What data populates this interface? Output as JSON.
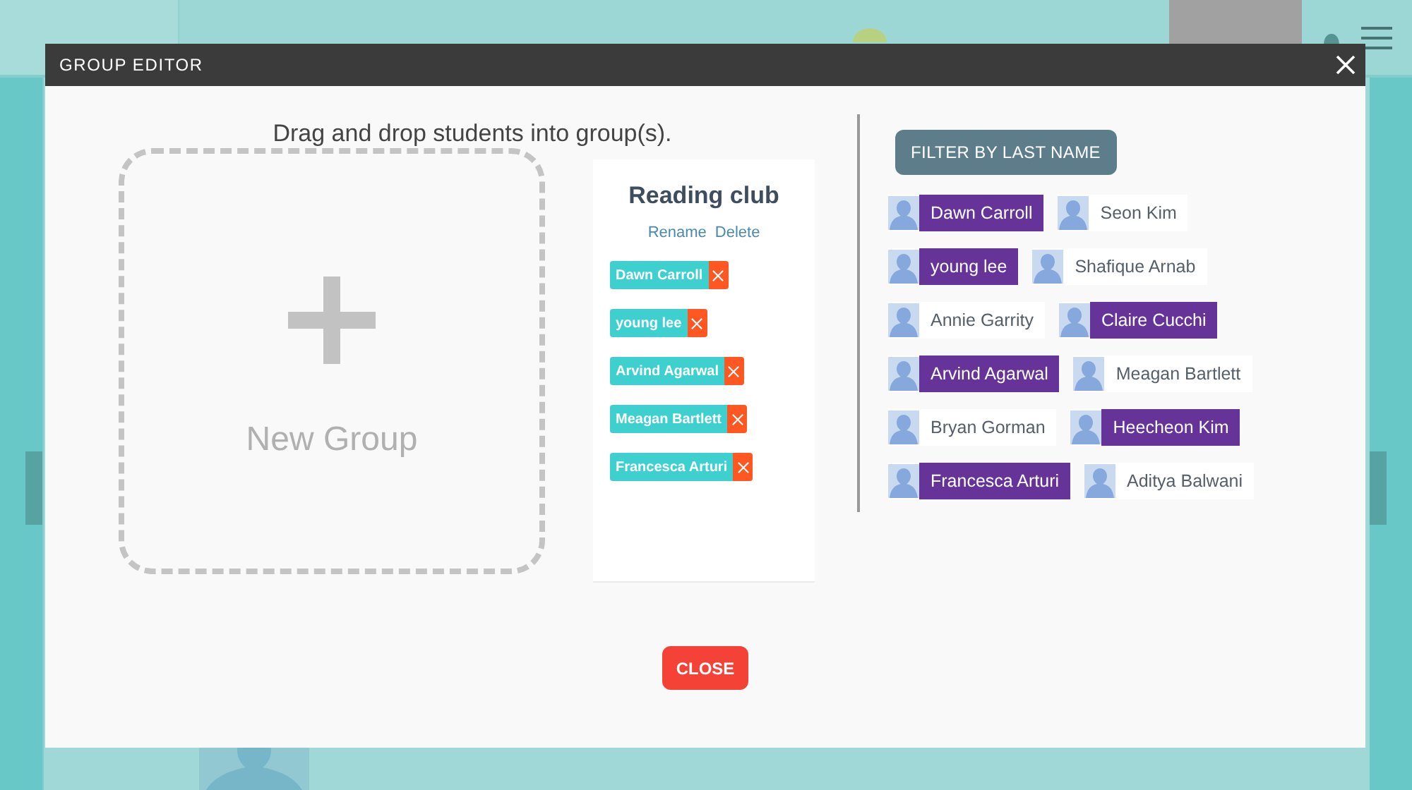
{
  "nav": {
    "tabs": [
      {
        "selected": true
      },
      {
        "selected": false
      }
    ]
  },
  "dialog": {
    "title": "GROUP EDITOR",
    "instructions": "Drag and drop students into group(s).",
    "new_group": "New Group",
    "groups": [
      {
        "name": "Reading club",
        "actions": [
          "Rename",
          "Delete"
        ],
        "members": [
          "Dawn Carroll",
          "young lee",
          "Arvind Agarwal",
          "Meagan Bartlett",
          "Francesca Arturi"
        ]
      }
    ],
    "filter_button": "FILTER BY LAST NAME",
    "students": [
      {
        "name": "Dawn Carroll",
        "selected": true
      },
      {
        "name": "Seon Kim",
        "selected": false
      },
      {
        "name": "young lee",
        "selected": true
      },
      {
        "name": "Shafique Arnab",
        "selected": false
      },
      {
        "name": "Annie Garrity",
        "selected": false
      },
      {
        "name": "Claire Cucchi",
        "selected": true
      },
      {
        "name": "Arvind Agarwal",
        "selected": true
      },
      {
        "name": "Meagan Bartlett",
        "selected": false
      },
      {
        "name": "Bryan Gorman",
        "selected": false
      },
      {
        "name": "Heecheon Kim",
        "selected": true
      },
      {
        "name": "Francesca Arturi",
        "selected": true
      },
      {
        "name": "Aditya Balwani",
        "selected": false
      }
    ],
    "close_button": "CLOSE"
  }
}
